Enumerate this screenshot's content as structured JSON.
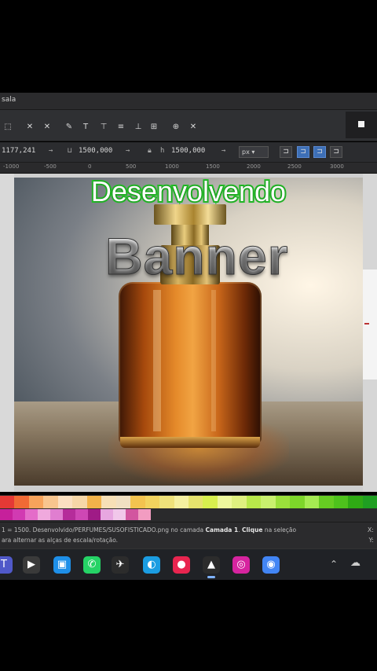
{
  "app": {
    "menubar_title": "sala"
  },
  "toolbar1": {
    "icons": [
      "node-icon",
      "cut-icon",
      "delete-icon",
      "pen-icon",
      "text-icon",
      "align-top-icon",
      "align-middle-icon",
      "align-bottom-icon",
      "zoom-icon",
      "transform-icon"
    ]
  },
  "toolbar2": {
    "x_value": "1177,241",
    "w_value": "1500,000",
    "h_value": "1500,000",
    "unit": "px",
    "unit_arrow": "▾"
  },
  "ruler": {
    "labels": [
      "-1000",
      "-500",
      "0",
      "500",
      "1000",
      "1500",
      "2000",
      "2500",
      "3000"
    ]
  },
  "banner": {
    "headline": "Desenvolvendo",
    "subheadline": "Banner"
  },
  "palette": {
    "row1": [
      "#e53935",
      "#f06a35",
      "#f7a35b",
      "#f8c58e",
      "#fbe0c1",
      "#f6d7a7",
      "#f2b34a",
      "#f7e0b6",
      "#f0e0c2",
      "#f3c34f",
      "#f2d35e",
      "#efe27a",
      "#f5f0a0",
      "#e6e36d",
      "#d8f04e",
      "#eef89c",
      "#dff07f",
      "#b8e84a",
      "#c9f06e",
      "#9be03b",
      "#7dd62a",
      "#a5eb52",
      "#66cc22",
      "#4ec21c",
      "#2faa14",
      "#1f9f22"
    ],
    "row2": [
      "#c6209b",
      "#d13ab2",
      "#e46cc9",
      "#f0a9dd",
      "#e07ed0",
      "#b52c9a",
      "#ce47b4",
      "#9f1b86",
      "#e7a6e0",
      "#f1c7ea",
      "#d2559f",
      "#f29cc1"
    ]
  },
  "status": {
    "line1_prefix": "1 = 1500. Desenvolvido/PERFUMES/SUSOFISTICADO.png no camada ",
    "line1_layer": "Camada 1",
    "line1_mid": ". ",
    "line1_click": "Clique",
    "line1_suffix": " na seleção",
    "line2": "ara alternar as alças de escala/rotação.",
    "right1": "X:",
    "right2": "Y:"
  },
  "taskbar": {
    "apps": [
      {
        "name": "teams-icon",
        "glyph": "T",
        "color": "#5059c9"
      },
      {
        "name": "media-player-icon",
        "glyph": "▶",
        "color": "#3a3a3a"
      },
      {
        "name": "capcut-icon",
        "glyph": "▣",
        "color": "#1e8fe8"
      },
      {
        "name": "whatsapp-icon",
        "glyph": "✆",
        "color": "#25d366"
      },
      {
        "name": "network-icon",
        "glyph": "✈",
        "color": "#2c2c2c"
      },
      {
        "name": "edge-icon",
        "glyph": "◐",
        "color": "#1b9de2"
      },
      {
        "name": "recorder-icon",
        "glyph": "●",
        "color": "#e8254f"
      },
      {
        "name": "inkscape-icon",
        "glyph": "▲",
        "color": "#2c2c2c"
      },
      {
        "name": "instagram-icon",
        "glyph": "◎",
        "color": "#d6249f"
      },
      {
        "name": "chrome-icon",
        "glyph": "◉",
        "color": "#4285f4"
      }
    ],
    "tray": [
      "chevron-up-icon",
      "cloud-icon"
    ]
  }
}
